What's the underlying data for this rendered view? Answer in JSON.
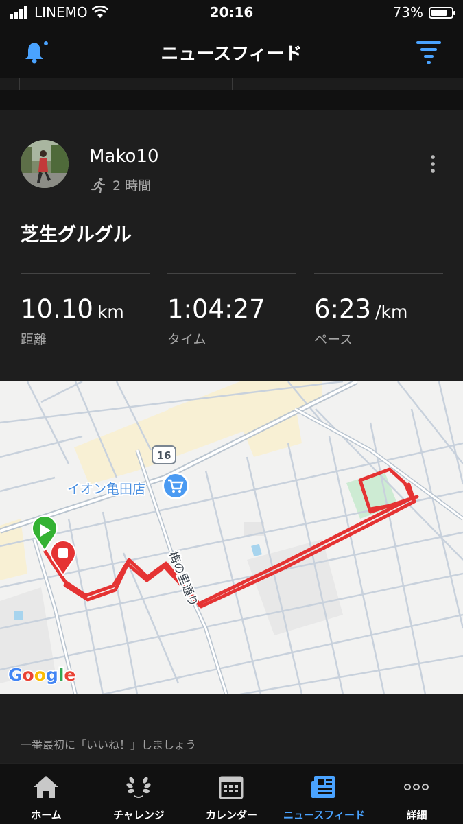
{
  "status_bar": {
    "carrier": "LINEMO",
    "time": "20:16",
    "battery": "73%"
  },
  "header": {
    "title": "ニュースフィード"
  },
  "post": {
    "username": "Mako10",
    "time_ago": "2 時間",
    "title": "芝生グルグル",
    "stats": [
      {
        "value": "10.10",
        "unit": "km",
        "label": "距離"
      },
      {
        "value": "1:04:27",
        "unit": "",
        "label": "タイム"
      },
      {
        "value": "6:23",
        "unit": "/km",
        "label": "ペース"
      }
    ],
    "map": {
      "road_number": "16",
      "place_label": "イオン亀田店",
      "street_label": "梅の里通り",
      "attribution": "Google"
    },
    "likes_prompt": "一番最初に「いいね！」しましょう"
  },
  "tabs": [
    {
      "label": "ホーム",
      "icon": "home-icon",
      "active": false
    },
    {
      "label": "チャレンジ",
      "icon": "laurel-icon",
      "active": false
    },
    {
      "label": "カレンダー",
      "icon": "calendar-icon",
      "active": false
    },
    {
      "label": "ニュースフィード",
      "icon": "newsfeed-icon",
      "active": true
    },
    {
      "label": "詳細",
      "icon": "more-dots-icon",
      "active": false
    }
  ],
  "colors": {
    "accent": "#4aa3ff",
    "route": "#e53333",
    "start": "#34b233",
    "stop": "#e53333"
  }
}
